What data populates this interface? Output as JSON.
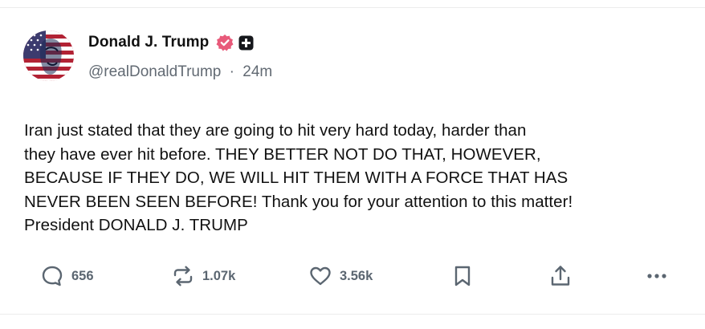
{
  "post": {
    "author": {
      "display_name": "Donald J. Trump",
      "handle": "@realDonaldTrump",
      "separator": "·",
      "time_ago": "24m",
      "avatar_icon": "flag-portrait-avatar",
      "verified_icon": "verified-badge-icon",
      "verified_color": "#e85a7a",
      "extra_badge_icon": "plus-badge-icon"
    },
    "text": "Iran just stated that they are going to hit very hard today, harder than\nthey have ever hit before. THEY BETTER NOT DO THAT, HOWEVER,\nBECAUSE IF THEY DO, WE WILL HIT THEM WITH A FORCE THAT HAS\nNEVER BEEN SEEN BEFORE! Thank you for your attention to this matter!\nPresident DONALD J. TRUMP",
    "actions": {
      "replies": "656",
      "reposts": "1.07k",
      "likes": "3.56k"
    }
  },
  "colors": {
    "action_gray": "#5b6671",
    "text": "#111111",
    "handle_gray": "#626a73"
  }
}
